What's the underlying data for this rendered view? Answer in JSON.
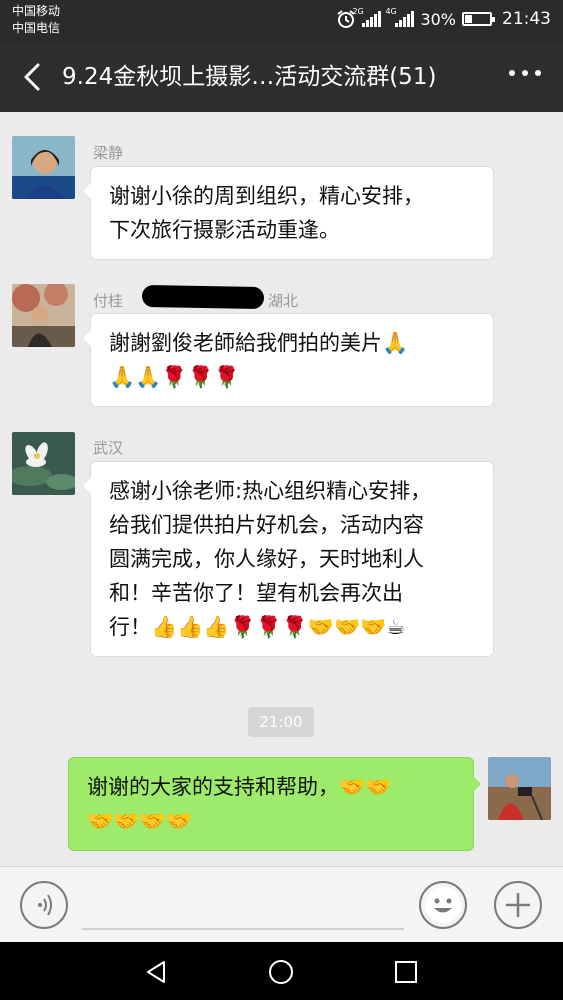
{
  "status_bar": {
    "carrier_1": "中国移动",
    "carrier_2": "中国电信",
    "network_1": "2G",
    "network_2": "4G",
    "battery": "30%",
    "battery_level": 0.3,
    "time": "21:43"
  },
  "header": {
    "title": "9.24金秋坝上摄影…活动交流群(51)"
  },
  "messages": [
    {
      "sender": "梁静",
      "lines": [
        "谢谢小徐的周到组织，精心安排，",
        "下次旅行摄影活动重逢。"
      ]
    },
    {
      "sender_prefix": "付桂",
      "sender_suffix": "湖北",
      "lines": [
        "謝謝劉俊老師給我們拍的美片🙏",
        "🙏🙏🌹🌹🌹"
      ]
    },
    {
      "sender": "武汉",
      "lines": [
        "感谢小徐老师:热心组织精心安排，",
        "给我们提供拍片好机会，活动内容",
        "圆满完成，你人缘好，天时地利人",
        "和！辛苦你了！望有机会再次出",
        "行！👍👍👍🌹🌹🌹🤝🤝🤝☕"
      ]
    }
  ],
  "timestamp": "21:00",
  "own_message": {
    "lines": [
      "谢谢的大家的支持和帮助，🤝🤝",
      "🤝🤝🤝🤝"
    ]
  },
  "icons": {
    "back": "back-arrow-icon",
    "more": "more-icon",
    "voice": "voice-icon",
    "emoji": "emoji-icon",
    "plus": "plus-icon",
    "nav_back": "nav-back-icon",
    "nav_home": "nav-home-icon",
    "nav_recent": "nav-recent-icon"
  },
  "colors": {
    "own_bubble": "#9eea6a",
    "header_bg": "#2e2e2e"
  }
}
